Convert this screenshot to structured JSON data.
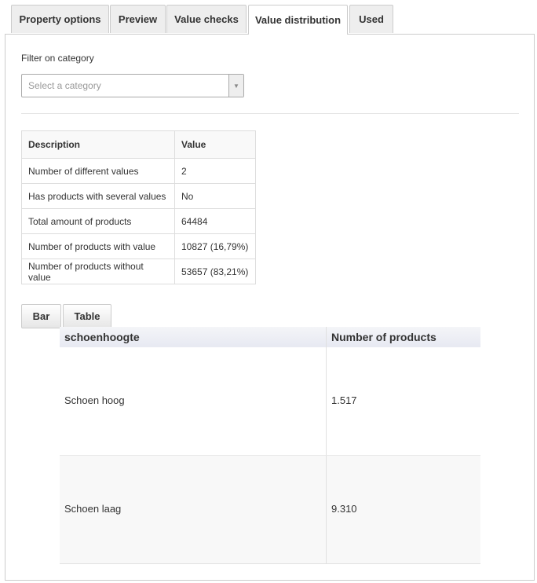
{
  "tabs": [
    {
      "label": "Property options",
      "active": false
    },
    {
      "label": "Preview",
      "active": false
    },
    {
      "label": "Value checks",
      "active": false
    },
    {
      "label": "Value distribution",
      "active": true
    },
    {
      "label": "Used",
      "active": false
    }
  ],
  "filter": {
    "label": "Filter on category",
    "placeholder": "Select a category",
    "arrow": "▼"
  },
  "stats": {
    "headers": [
      "Description",
      "Value"
    ],
    "rows": [
      {
        "description": "Number of different values",
        "value": "2"
      },
      {
        "description": "Has products with several values",
        "value": "No"
      },
      {
        "description": "Total amount of products",
        "value": "64484"
      },
      {
        "description": "Number of products with value",
        "value": "10827 (16,79%)"
      },
      {
        "description": "Number of products without value",
        "value": "53657 (83,21%)"
      }
    ]
  },
  "view_buttons": {
    "bar": "Bar",
    "table": "Table"
  },
  "distribution": {
    "headers": [
      "schoenhoogte",
      "Number of products"
    ],
    "rows": [
      {
        "value": "Schoen hoog",
        "count": "1.517"
      },
      {
        "value": "Schoen laag",
        "count": "9.310"
      }
    ]
  }
}
